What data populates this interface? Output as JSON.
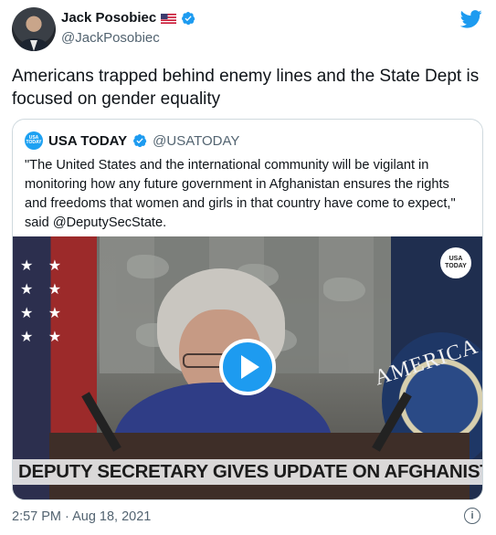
{
  "author": {
    "name": "Jack Posobiec",
    "handle": "@JackPosobiec",
    "flag_icon": "us-flag-icon",
    "verified_icon": "verified-badge-icon"
  },
  "tweet": {
    "text": "Americans trapped behind enemy lines and the State Dept is focused on gender equality",
    "timestamp": "2:57 PM · Aug 18, 2021"
  },
  "quoted": {
    "name": "USA TODAY",
    "handle": "@USATODAY",
    "logo_text": "USA TODAY",
    "text": "\"The United States and the international community will be vigilant in monitoring how any future government in Afghanistan ensures the rights and freedoms that women and girls in that country have come to expect,\" said @DeputySecState.",
    "video": {
      "watermark": "USA TODAY",
      "caption": "DEPUTY SECRETARY GIVES UPDATE ON AFGHANISTAN",
      "seal_text": "AMERICA"
    }
  },
  "icons": {
    "brand": "twitter-bird-icon",
    "play": "play-icon",
    "info": "info-icon"
  },
  "colors": {
    "accent": "#1d9bf0",
    "muted": "#536471",
    "border": "#cfd9de"
  }
}
